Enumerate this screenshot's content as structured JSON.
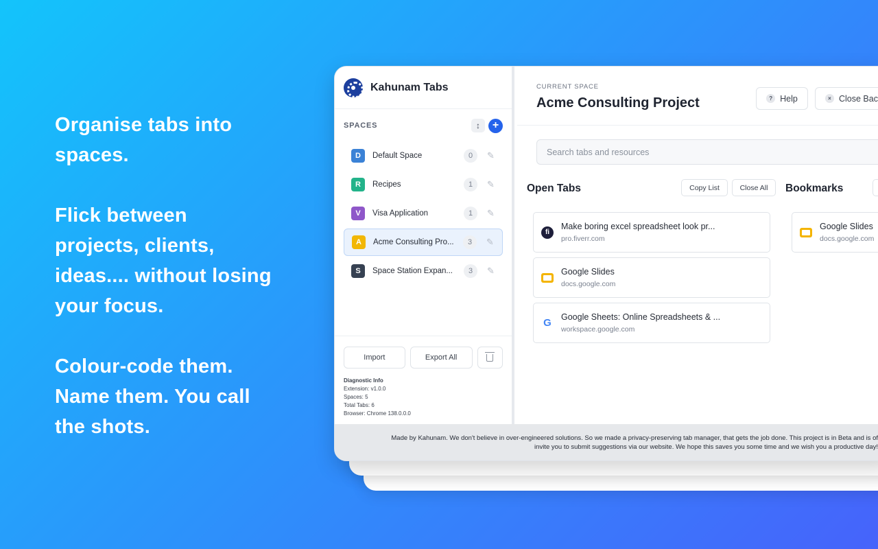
{
  "promo": {
    "paragraphs": [
      "Organise tabs into spaces.",
      "Flick between projects, clients, ideas.... without losing your focus.",
      "Colour-code them. Name them. You call the shots."
    ]
  },
  "app": {
    "name": "Kahunam Tabs"
  },
  "sidebar": {
    "spaces_label": "SPACES",
    "reorder_icon": "↕",
    "add_icon": "+",
    "spaces": [
      {
        "letter": "D",
        "name": "Default Space",
        "count": "0",
        "color": "#3b82d6"
      },
      {
        "letter": "R",
        "name": "Recipes",
        "count": "1",
        "color": "#23b38a"
      },
      {
        "letter": "V",
        "name": "Visa Application",
        "count": "1",
        "color": "#8f57c9"
      },
      {
        "letter": "A",
        "name": "Acme Consulting Pro...",
        "count": "3",
        "color": "#f2b705"
      },
      {
        "letter": "S",
        "name": "Space Station Expan...",
        "count": "3",
        "color": "#364152"
      }
    ],
    "edit_icon": "✎",
    "import_label": "Import",
    "export_label": "Export All",
    "diagnostic": {
      "title": "Diagnostic Info",
      "lines": [
        "Extension: v1.0.0",
        "Spaces: 5",
        "Total Tabs: 6",
        "Browser: Chrome 138.0.0.0"
      ]
    }
  },
  "main": {
    "current_label": "CURRENT SPACE",
    "current_title": "Acme Consulting Project",
    "help_label": "Help",
    "help_icon": "?",
    "close_label": "Close Bac",
    "close_icon": "×",
    "search_placeholder": "Search tabs and resources",
    "open_tabs_title": "Open Tabs",
    "copy_list_label": "Copy List",
    "close_all_label": "Close All",
    "bookmarks_title": "Bookmarks",
    "open_tabs": [
      {
        "title": "Make boring excel spreadsheet look pr...",
        "url": "pro.fiverr.com",
        "icon": "fiverr-icon",
        "glyph": "fi"
      },
      {
        "title": "Google Slides",
        "url": "docs.google.com",
        "icon": "google-slides-icon",
        "glyph": ""
      },
      {
        "title": "Google Sheets: Online Spreadsheets & ...",
        "url": "workspace.google.com",
        "icon": "google-icon",
        "glyph": "G"
      }
    ],
    "bookmarks": [
      {
        "title": "Google Slides",
        "url": "docs.google.com",
        "icon": "google-slides-icon"
      }
    ]
  },
  "footer": {
    "line1": "Made by Kahunam. We don't believe in over-engineered solutions. So we made a privacy-preserving tab manager, that gets the job done. This project is in Beta and is of",
    "line2": "invite you to submit suggestions via our website. We hope this saves you some time and we wish you a productive day!"
  }
}
